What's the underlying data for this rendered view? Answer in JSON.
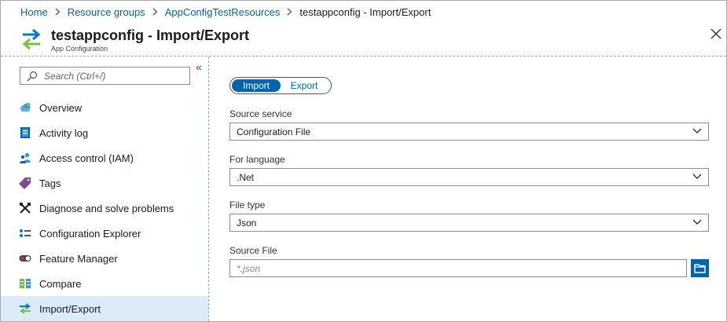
{
  "breadcrumb": [
    {
      "label": "Home"
    },
    {
      "label": "Resource groups"
    },
    {
      "label": "AppConfigTestResources"
    },
    {
      "label": "testappconfig - Import/Export"
    }
  ],
  "header": {
    "title": "testappconfig - Import/Export",
    "subtitle": "App Configuration",
    "icon": "import-export-arrows-icon",
    "close_icon": "close-icon"
  },
  "sidebar": {
    "collapse_label": "«",
    "search_placeholder": "Search (Ctrl+/)",
    "items": [
      {
        "label": "Overview",
        "icon": "overview-cloud-icon"
      },
      {
        "label": "Activity log",
        "icon": "activity-log-icon"
      },
      {
        "label": "Access control (IAM)",
        "icon": "people-icon"
      },
      {
        "label": "Tags",
        "icon": "tag-icon"
      },
      {
        "label": "Diagnose and solve problems",
        "icon": "wrench-icon"
      },
      {
        "label": "Configuration Explorer",
        "icon": "configuration-list-icon"
      },
      {
        "label": "Feature Manager",
        "icon": "toggle-icon"
      },
      {
        "label": "Compare",
        "icon": "compare-icon"
      },
      {
        "label": "Import/Export",
        "icon": "import-export-icon",
        "active": true
      }
    ]
  },
  "main": {
    "toggle": {
      "import_label": "Import",
      "export_label": "Export",
      "selected": "Import"
    },
    "source_service": {
      "label": "Source service",
      "value": "Configuration File"
    },
    "language": {
      "label": "For language",
      "value": ".Net"
    },
    "file_type": {
      "label": "File type",
      "value": "Json"
    },
    "source_file": {
      "label": "Source File",
      "placeholder": "*.json",
      "browse_icon": "folder-icon"
    }
  },
  "colors": {
    "accent": "#0063b1",
    "active_bg": "#dcebf8",
    "link": "#0063b1",
    "icon_green": "#7ac143"
  }
}
